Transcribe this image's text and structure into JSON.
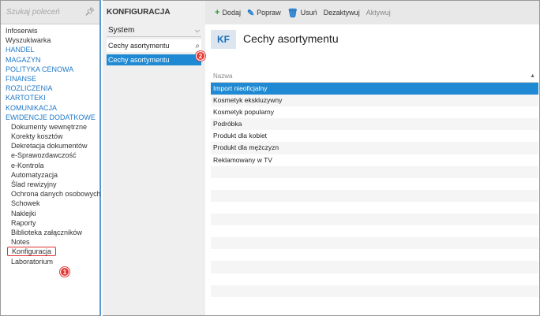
{
  "nav": {
    "search_placeholder": "Szukaj poleceń",
    "items": [
      {
        "label": "Infoserwis",
        "type": "plain"
      },
      {
        "label": "Wyszukiwarka",
        "type": "plain"
      },
      {
        "label": "HANDEL",
        "type": "cat"
      },
      {
        "label": "MAGAZYN",
        "type": "cat"
      },
      {
        "label": "POLITYKA CENOWA",
        "type": "cat"
      },
      {
        "label": "FINANSE",
        "type": "cat"
      },
      {
        "label": "ROZLICZENIA",
        "type": "cat"
      },
      {
        "label": "KARTOTEKI",
        "type": "cat"
      },
      {
        "label": "KOMUNIKACJA",
        "type": "cat"
      },
      {
        "label": "EWIDENCJE DODATKOWE",
        "type": "cat"
      },
      {
        "label": "Dokumenty wewnętrzne",
        "type": "sub"
      },
      {
        "label": "Korekty kosztów",
        "type": "sub"
      },
      {
        "label": "Dekretacja dokumentów",
        "type": "sub"
      },
      {
        "label": "e-Sprawozdawczość",
        "type": "sub"
      },
      {
        "label": "e-Kontrola",
        "type": "sub"
      },
      {
        "label": "Automatyzacja",
        "type": "sub"
      },
      {
        "label": "Ślad rewizyjny",
        "type": "sub"
      },
      {
        "label": "Ochrona danych osobowych",
        "type": "sub"
      },
      {
        "label": "Schowek",
        "type": "sub"
      },
      {
        "label": "Naklejki",
        "type": "sub"
      },
      {
        "label": "Raporty",
        "type": "sub"
      },
      {
        "label": "Biblioteka załączników",
        "type": "sub"
      },
      {
        "label": "Notes",
        "type": "sub"
      },
      {
        "label": "Konfiguracja",
        "type": "sub",
        "selected": true
      },
      {
        "label": "Laboratorium",
        "type": "sub"
      }
    ]
  },
  "mid": {
    "title": "KONFIGURACJA",
    "dropdown_value": "System",
    "search_value": "Cechy asortymentu",
    "selected_item": "Cechy asortymentu"
  },
  "toolbar": {
    "add": "Dodaj",
    "edit": "Popraw",
    "delete": "Usuń",
    "deactivate": "Dezaktywuj",
    "activate": "Aktywuj"
  },
  "main": {
    "badge": "KF",
    "title": "Cechy asortymentu",
    "column": "Nazwa",
    "rows": [
      "Import nieoficjalny",
      "Kosmetyk ekskluzywny",
      "Kosmetyk popularny",
      "Podróbka",
      "Produkt dla kobiet",
      "Produkt dla mężczyzn",
      "Reklamowany w TV"
    ],
    "empty_rows": 11
  },
  "annotations": {
    "badge1": "1",
    "badge2": "2"
  },
  "colors": {
    "accent": "#1f8ad3",
    "category": "#1f79c9",
    "badge": "#e53935"
  }
}
